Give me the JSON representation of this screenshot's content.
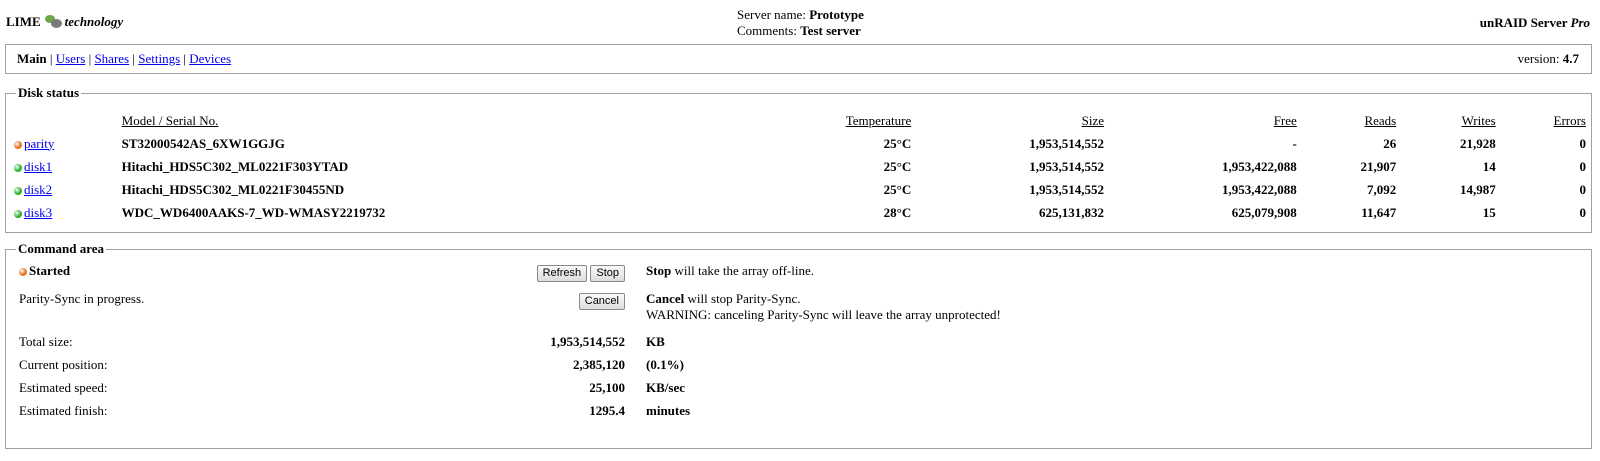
{
  "header": {
    "logo_left": "LIME",
    "logo_right": "technology",
    "server_name_label": "Server name:",
    "server_name": "Prototype",
    "comments_label": "Comments:",
    "comments": "Test server",
    "brand": "unRAID Server",
    "brand_edition": "Pro"
  },
  "nav": {
    "items": [
      {
        "label": "Main",
        "active": true
      },
      {
        "label": "Users"
      },
      {
        "label": "Shares"
      },
      {
        "label": "Settings"
      },
      {
        "label": "Devices"
      }
    ],
    "separator": "|",
    "version_label": "version:",
    "version": "4.7"
  },
  "disk_status": {
    "legend": "Disk status",
    "columns": {
      "model": "Model / Serial No.",
      "temperature": "Temperature",
      "size": "Size",
      "free": "Free",
      "reads": "Reads",
      "writes": "Writes",
      "errors": "Errors"
    },
    "rows": [
      {
        "name": "parity",
        "status_color": "#e8701e",
        "model": "ST32000542AS_6XW1GGJG",
        "temperature": "25°C",
        "size": "1,953,514,552",
        "free": "-",
        "reads": "26",
        "writes": "21,928",
        "errors": "0"
      },
      {
        "name": "disk1",
        "status_color": "#2bb12b",
        "model": "Hitachi_HDS5C302_ML0221F303YTAD",
        "temperature": "25°C",
        "size": "1,953,514,552",
        "free": "1,953,422,088",
        "reads": "21,907",
        "writes": "14",
        "errors": "0"
      },
      {
        "name": "disk2",
        "status_color": "#2bb12b",
        "model": "Hitachi_HDS5C302_ML0221F30455ND",
        "temperature": "25°C",
        "size": "1,953,514,552",
        "free": "1,953,422,088",
        "reads": "7,092",
        "writes": "14,987",
        "errors": "0"
      },
      {
        "name": "disk3",
        "status_color": "#2bb12b",
        "model": "WDC_WD6400AAKS-7_WD-WMASY2219732",
        "temperature": "28°C",
        "size": "625,131,832",
        "free": "625,079,908",
        "reads": "11,647",
        "writes": "15",
        "errors": "0"
      }
    ]
  },
  "command_area": {
    "legend": "Command area",
    "status": "Started",
    "status_color": "#e8701e",
    "refresh_label": "Refresh",
    "stop_label": "Stop",
    "stop_desc_bold": "Stop",
    "stop_desc": "will take the array off-line.",
    "parity_msg": "Parity-Sync in progress.",
    "cancel_label": "Cancel",
    "cancel_desc_bold": "Cancel",
    "cancel_desc": "will stop Parity-Sync.",
    "warning": "WARNING: canceling Parity-Sync will leave the array unprotected!",
    "stats": [
      {
        "label": "Total size:",
        "value": "1,953,514,552",
        "unit": "KB"
      },
      {
        "label": "Current position:",
        "value": "2,385,120",
        "unit": "(0.1%)"
      },
      {
        "label": "Estimated speed:",
        "value": "25,100",
        "unit": "KB/sec"
      },
      {
        "label": "Estimated finish:",
        "value": "1295.4",
        "unit": "minutes"
      }
    ]
  },
  "colors": {
    "link": "#0000ee",
    "border": "#a0a0a0",
    "status_orange": "#e8701e",
    "status_green": "#2bb12b"
  }
}
